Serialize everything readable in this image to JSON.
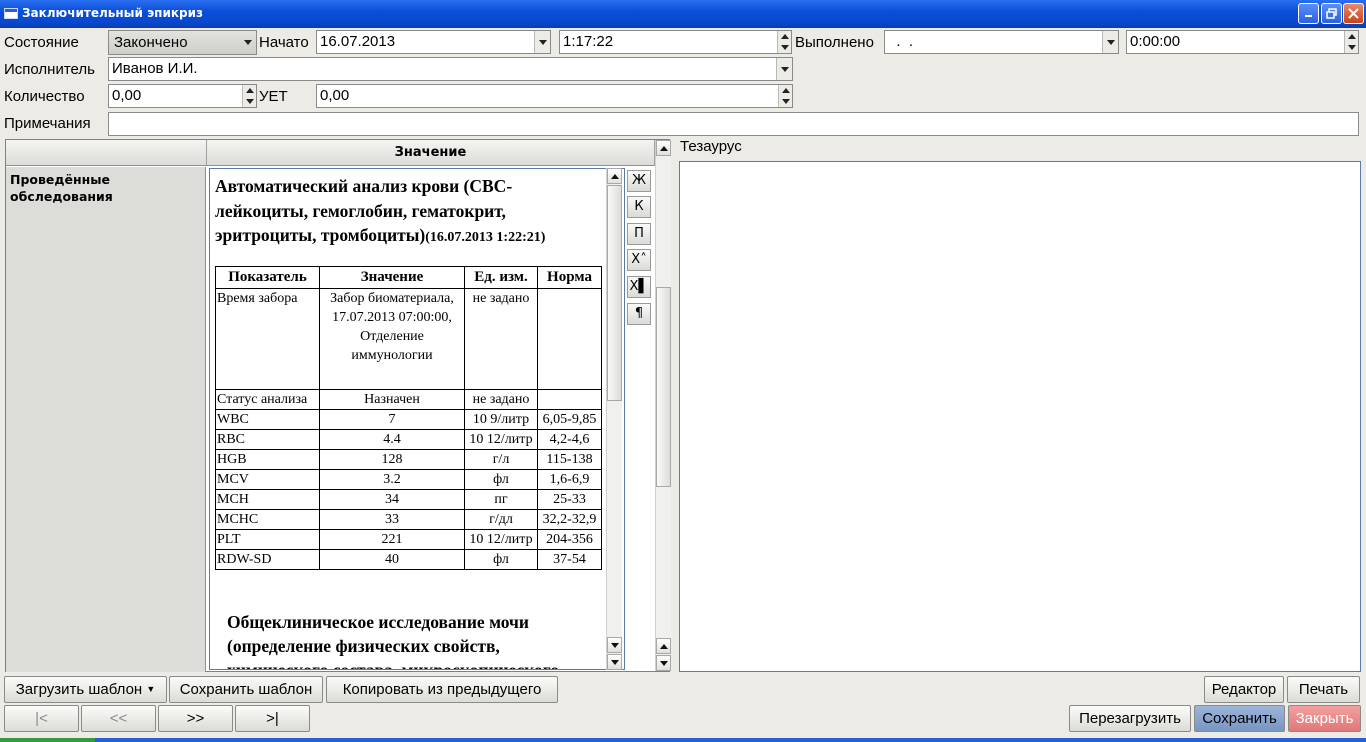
{
  "window": {
    "title": "Заключительный эпикриз"
  },
  "form": {
    "state_label": "Состояние",
    "state_value": "Закончено",
    "start_label": "Начато",
    "start_date": "16.07.2013",
    "start_time": "1:17:22",
    "done_label": "Выполнено",
    "done_date": "  .  .",
    "done_time": "0:00:00",
    "executor_label": "Исполнитель",
    "executor_value": "Иванов И.И.",
    "quantity_label": "Количество",
    "quantity_value": "0,00",
    "uet_label": "УЕТ",
    "uet_value": "0,00",
    "notes_label": "Примечания",
    "notes_value": ""
  },
  "grid": {
    "col_value": "Значение",
    "row_label": "Проведённые обследования"
  },
  "doc": {
    "title_bold": "Автоматический анализ крови",
    "title_rest": " (CBC-лейкоциты, гемоглобин, гематокрит, эритроциты, тромбоциты)",
    "title_ts": "(16.07.2013 1:22:21)",
    "headers": [
      "Показатель",
      "Значение",
      "Ед. изм.",
      "Норма"
    ],
    "rows": [
      [
        "Время забора",
        "Забор биоматериала, 17.07.2013 07:00:00, Отделение иммунологии",
        "не задано",
        ""
      ],
      [
        "Статус анализа",
        "Назначен",
        "не задано",
        ""
      ],
      [
        "WBC",
        "7",
        "10 9/литр",
        "6,05-9,85"
      ],
      [
        "RBC",
        "4.4",
        "10 12/литр",
        "4,2-4,6"
      ],
      [
        "HGB",
        "128",
        "г/л",
        "115-138"
      ],
      [
        "MCV",
        "3.2",
        "фл",
        "1,6-6,9"
      ],
      [
        "MCH",
        "34",
        "пг",
        "25-33"
      ],
      [
        "MCHC",
        "33",
        "г/дл",
        "32,2-32,9"
      ],
      [
        "PLT",
        "221",
        "10 12/литр",
        "204-356"
      ],
      [
        "RDW-SD",
        "40",
        "фл",
        "37-54"
      ]
    ],
    "section2": "Общеклиническое исследование мочи (определение физических свойств, химического состава, микроскопического"
  },
  "format_buttons": [
    "Ж",
    "К",
    "П",
    "X˄",
    "X▌",
    "¶"
  ],
  "thesaurus_label": "Тезаурус",
  "buttons": {
    "load_template": "Загрузить шаблон",
    "save_template": "Сохранить шаблон",
    "copy_prev": "Копировать из предыдущего",
    "editor": "Редактор",
    "print": "Печать",
    "first": "|<",
    "prev": "<<",
    "next": ">>",
    "last": ">|",
    "reload": "Перезагрузить",
    "save": "Сохранить",
    "close": "Закрыть"
  }
}
